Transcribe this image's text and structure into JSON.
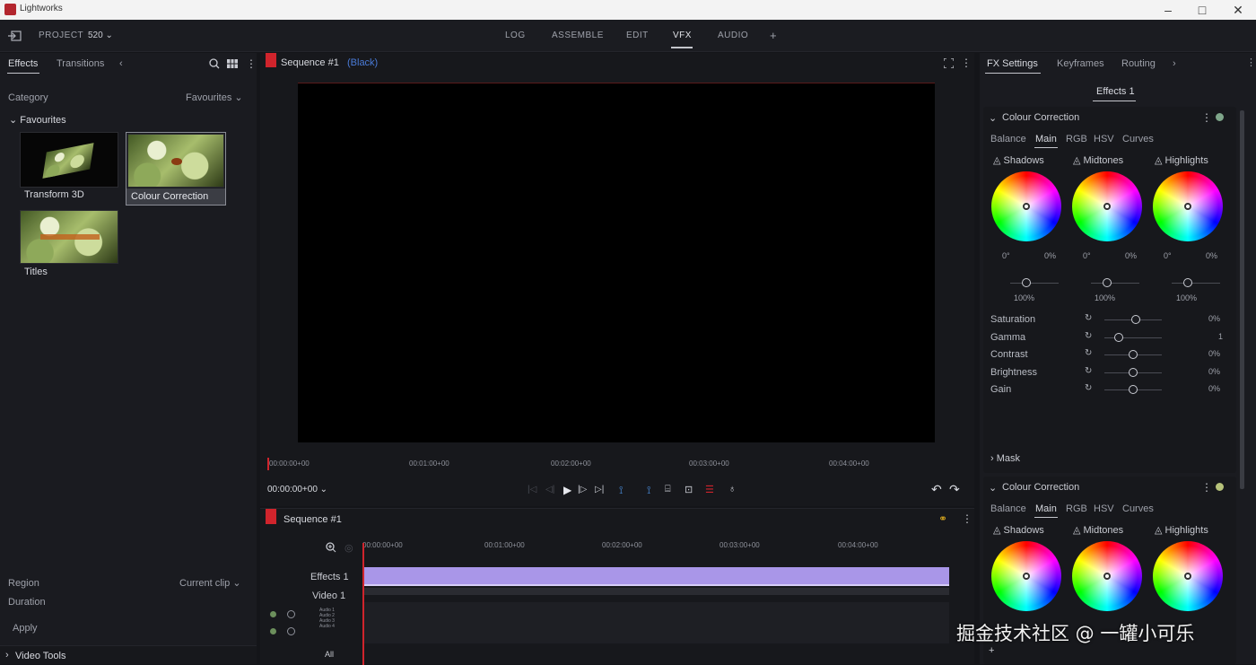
{
  "window": {
    "title": "Lightworks",
    "min": "–",
    "max": "□",
    "close": "✕"
  },
  "topbar": {
    "project_label": "PROJECT",
    "project_value": "520",
    "tabs": [
      "LOG",
      "ASSEMBLE",
      "EDIT",
      "VFX",
      "AUDIO"
    ],
    "active_tab": "VFX",
    "add": "+"
  },
  "left": {
    "tabs": [
      "Effects",
      "Transitions"
    ],
    "more": "‹",
    "category_label": "Category",
    "category_value": "Favourites",
    "group": "Favourites",
    "items": [
      "Transform 3D",
      "Colour Correction",
      "Titles"
    ],
    "region_label": "Region",
    "region_value": "Current clip",
    "duration_label": "Duration",
    "apply": "Apply",
    "video_tools": "Video Tools"
  },
  "viewer": {
    "title": "Sequence #1",
    "subtitle": "(Black)",
    "timecodes": [
      "00:00:00+00",
      "00:01:00+00",
      "00:02:00+00",
      "00:03:00+00",
      "00:04:00+00"
    ],
    "current_time": "00:00:00+00"
  },
  "timeline": {
    "title": "Sequence #1",
    "timecodes": [
      "00:00:00+00",
      "00:01:00+00",
      "00:02:00+00",
      "00:03:00+00",
      "00:04:00+00"
    ],
    "tracks": [
      "Effects 1",
      "Video 1"
    ],
    "audio_tracks": [
      "Audio 1",
      "Audio 2",
      "Audio 3",
      "Audio 4"
    ],
    "all": "All"
  },
  "fx": {
    "tabs": [
      "FX Settings",
      "Keyframes",
      "Routing"
    ],
    "more": "›",
    "effects_tab": "Effects 1",
    "section_title": "Colour Correction",
    "subtabs": [
      "Balance",
      "Main",
      "RGB",
      "HSV",
      "Curves"
    ],
    "active_subtab": "Main",
    "wheels": [
      "Shadows",
      "Midtones",
      "Highlights"
    ],
    "deg": "0°",
    "pct": "0%",
    "level": "100%",
    "params": [
      {
        "name": "Saturation",
        "value": "0%",
        "pos": 0.55
      },
      {
        "name": "Gamma",
        "value": "1",
        "pos": 0.2
      },
      {
        "name": "Contrast",
        "value": "0%",
        "pos": 0.5
      },
      {
        "name": "Brightness",
        "value": "0%",
        "pos": 0.5
      },
      {
        "name": "Gain",
        "value": "0%",
        "pos": 0.5
      }
    ],
    "mask": "Mask",
    "section2_title": "Colour Correction"
  },
  "watermark": "掘金技术社区 @ 一罐小可乐",
  "colors": {
    "accent_red": "#d0242c",
    "clip_purple": "#a996e8",
    "link_blue": "#4a7bd8"
  }
}
